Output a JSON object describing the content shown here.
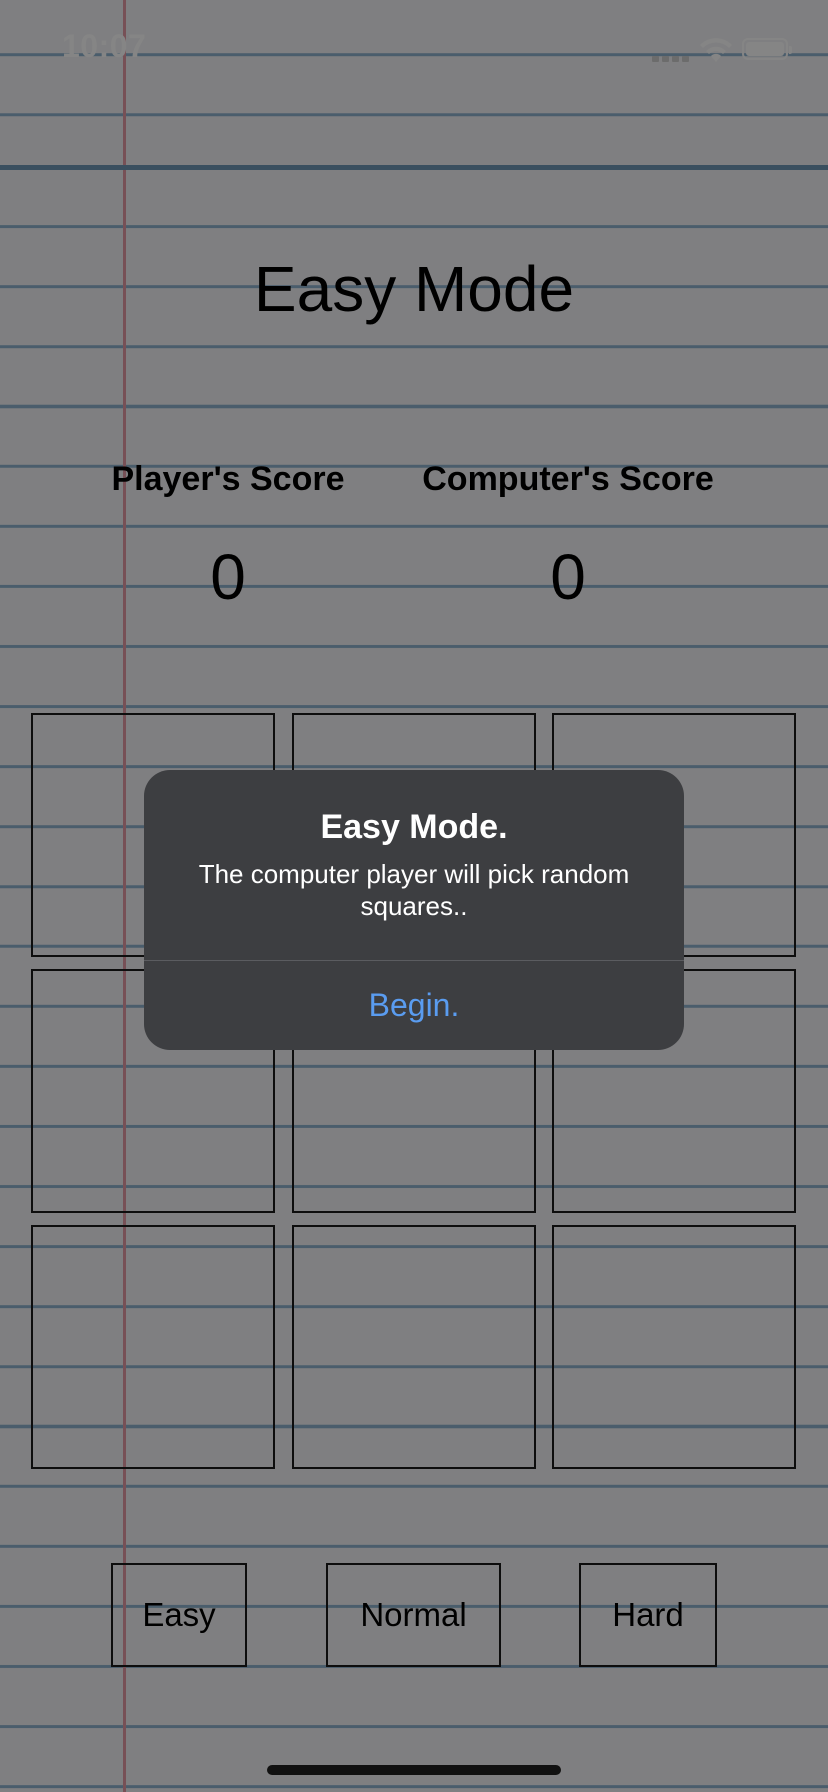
{
  "status_bar": {
    "time": "10:07",
    "signal_icon": "cellular-signal-icon",
    "wifi_icon": "wifi-icon",
    "battery_icon": "battery-icon"
  },
  "page": {
    "title": "Easy Mode"
  },
  "scores": {
    "player_label": "Player's Score",
    "player_value": "0",
    "computer_label": "Computer's Score",
    "computer_value": "0"
  },
  "board": {
    "cells": [
      "",
      "",
      "",
      "",
      "",
      "",
      "",
      "",
      ""
    ]
  },
  "modes": {
    "easy": "Easy",
    "normal": "Normal",
    "hard": "Hard"
  },
  "alert": {
    "title": "Easy Mode.",
    "message": "The computer player will pick random squares..",
    "button": "Begin."
  },
  "colors": {
    "accent": "#5a9cf0",
    "alert_background": "#3d3e41",
    "paper": "#f4f4f7",
    "ruled_line": "#8fb3cf",
    "margin_line": "#e59aa6"
  }
}
